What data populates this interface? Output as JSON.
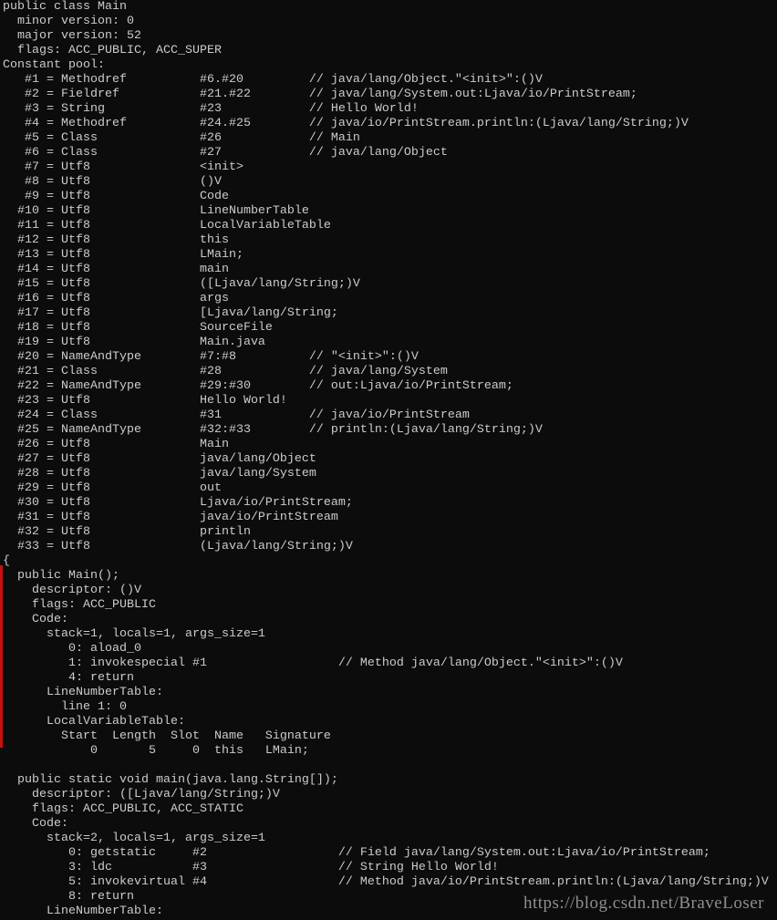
{
  "console": {
    "lines": [
      "public class Main",
      "  minor version: 0",
      "  major version: 52",
      "  flags: ACC_PUBLIC, ACC_SUPER",
      "Constant pool:",
      "   #1 = Methodref          #6.#20         // java/lang/Object.\"<init>\":()V",
      "   #2 = Fieldref           #21.#22        // java/lang/System.out:Ljava/io/PrintStream;",
      "   #3 = String             #23            // Hello World!",
      "   #4 = Methodref          #24.#25        // java/io/PrintStream.println:(Ljava/lang/String;)V",
      "   #5 = Class              #26            // Main",
      "   #6 = Class              #27            // java/lang/Object",
      "   #7 = Utf8               <init>",
      "   #8 = Utf8               ()V",
      "   #9 = Utf8               Code",
      "  #10 = Utf8               LineNumberTable",
      "  #11 = Utf8               LocalVariableTable",
      "  #12 = Utf8               this",
      "  #13 = Utf8               LMain;",
      "  #14 = Utf8               main",
      "  #15 = Utf8               ([Ljava/lang/String;)V",
      "  #16 = Utf8               args",
      "  #17 = Utf8               [Ljava/lang/String;",
      "  #18 = Utf8               SourceFile",
      "  #19 = Utf8               Main.java",
      "  #20 = NameAndType        #7:#8          // \"<init>\":()V",
      "  #21 = Class              #28            // java/lang/System",
      "  #22 = NameAndType        #29:#30        // out:Ljava/io/PrintStream;",
      "  #23 = Utf8               Hello World!",
      "  #24 = Class              #31            // java/io/PrintStream",
      "  #25 = NameAndType        #32:#33        // println:(Ljava/lang/String;)V",
      "  #26 = Utf8               Main",
      "  #27 = Utf8               java/lang/Object",
      "  #28 = Utf8               java/lang/System",
      "  #29 = Utf8               out",
      "  #30 = Utf8               Ljava/io/PrintStream;",
      "  #31 = Utf8               java/io/PrintStream",
      "  #32 = Utf8               println",
      "  #33 = Utf8               (Ljava/lang/String;)V",
      "{",
      "  public Main();",
      "    descriptor: ()V",
      "    flags: ACC_PUBLIC",
      "    Code:",
      "      stack=1, locals=1, args_size=1",
      "         0: aload_0",
      "         1: invokespecial #1                  // Method java/lang/Object.\"<init>\":()V",
      "         4: return",
      "      LineNumberTable:",
      "        line 1: 0",
      "      LocalVariableTable:",
      "        Start  Length  Slot  Name   Signature",
      "            0       5     0  this   LMain;",
      "",
      "  public static void main(java.lang.String[]);",
      "    descriptor: ([Ljava/lang/String;)V",
      "    flags: ACC_PUBLIC, ACC_STATIC",
      "    Code:",
      "      stack=2, locals=1, args_size=1",
      "         0: getstatic     #2                  // Field java/lang/System.out:Ljava/io/PrintStream;",
      "         3: ldc           #3                  // String Hello World!",
      "         5: invokevirtual #4                  // Method java/io/PrintStream.println:(Ljava/lang/String;)V",
      "         8: return",
      "      LineNumberTable:"
    ]
  },
  "watermark": "https://blog.csdn.net/BraveLoser",
  "colors": {
    "background": "#0c0c0c",
    "text": "#cccccc",
    "marker": "#c81010"
  }
}
